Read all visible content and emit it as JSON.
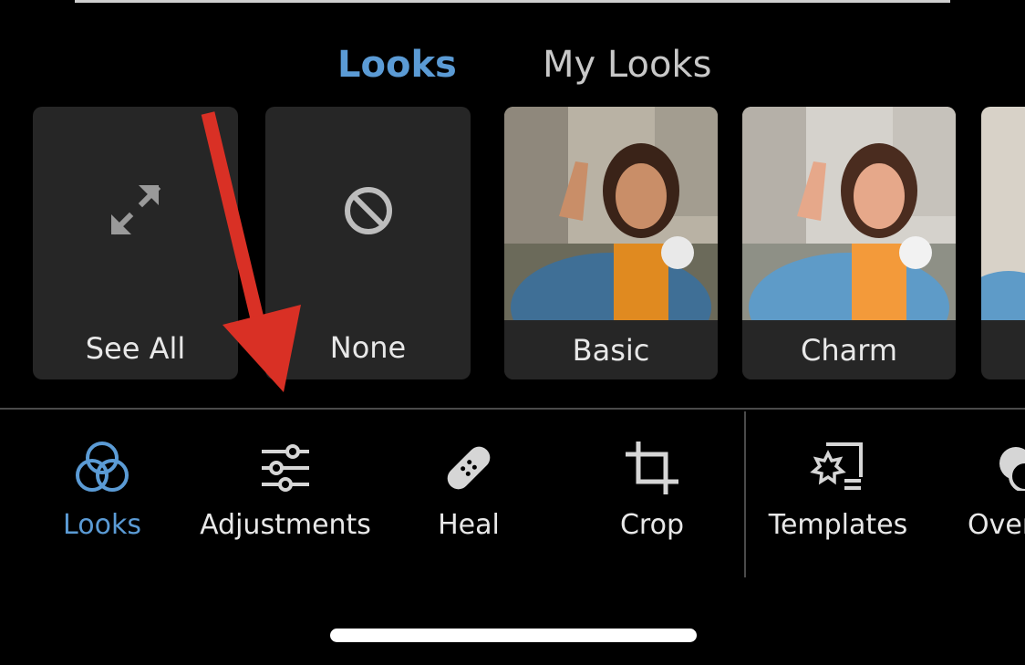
{
  "tabs": {
    "looks": "Looks",
    "my_looks": "My Looks",
    "active": "Looks"
  },
  "presets": [
    {
      "label": "See All",
      "icon": "expand-arrows-icon"
    },
    {
      "label": "None",
      "icon": "no-symbol-icon"
    },
    {
      "label": "Basic",
      "icon": "photo-thumbnail"
    },
    {
      "label": "Charm",
      "icon": "photo-thumbnail"
    }
  ],
  "tools": [
    {
      "label": "Looks",
      "icon": "looks-circles-icon",
      "active": true
    },
    {
      "label": "Adjustments",
      "icon": "sliders-icon",
      "active": false
    },
    {
      "label": "Heal",
      "icon": "bandage-icon",
      "active": false
    },
    {
      "label": "Crop",
      "icon": "crop-icon",
      "active": false
    },
    {
      "label": "Templates",
      "icon": "templates-icon",
      "active": false
    },
    {
      "label": "Over",
      "icon": "overlay-icon",
      "active": false
    }
  ],
  "colors": {
    "accent": "#5b9bd5",
    "card": "#262626",
    "annotation_arrow": "#d93025"
  }
}
